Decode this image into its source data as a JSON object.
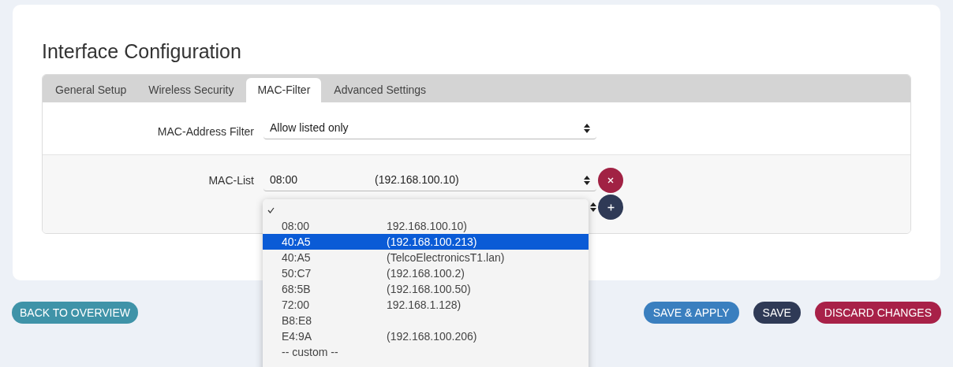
{
  "title": "Interface Configuration",
  "tabs": [
    {
      "label": "General Setup",
      "selected": false
    },
    {
      "label": "Wireless Security",
      "selected": false
    },
    {
      "label": "MAC-Filter",
      "selected": true
    },
    {
      "label": "Advanced Settings",
      "selected": false
    }
  ],
  "mac_address_filter": {
    "label": "MAC-Address Filter",
    "value": "Allow listed only"
  },
  "mac_list": {
    "label": "MAC-List",
    "value": {
      "mac": "08:00",
      "host": "(192.168.100.10)"
    },
    "dropdown": {
      "blank_option_checked": true,
      "options": [
        {
          "mac": "08:00",
          "host": "192.168.100.10)",
          "selected": false
        },
        {
          "mac": "40:A5",
          "host": "(192.168.100.213)",
          "selected": true
        },
        {
          "mac": "40:A5",
          "host": "(TelcoElectronicsT1.lan)",
          "selected": false
        },
        {
          "mac": "50:C7",
          "host": "(192.168.100.2)",
          "selected": false
        },
        {
          "mac": "68:5B",
          "host": "(192.168.100.50)",
          "selected": false
        },
        {
          "mac": "72:00",
          "host": "192.168.1.128)",
          "selected": false
        },
        {
          "mac": "B8:E8",
          "selected": false
        },
        {
          "mac": "E4:9A",
          "host": "(192.168.100.206)",
          "selected": false
        },
        {
          "mac": "-- custom --",
          "selected": false
        }
      ]
    }
  },
  "buttons": {
    "back": "BACK TO OVERVIEW",
    "save_apply": "SAVE & APPLY",
    "save": "SAVE",
    "discard": "DISCARD CHANGES"
  }
}
